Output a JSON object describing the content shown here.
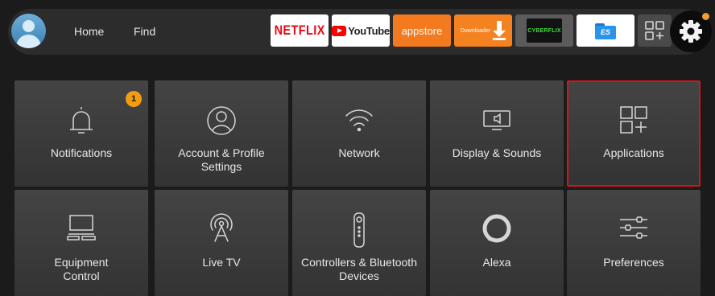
{
  "topbar": {
    "nav": {
      "home": "Home",
      "find": "Find"
    },
    "apps": {
      "netflix": "NETFLIX",
      "youtube": "YouTube",
      "appstore": "appstore",
      "downloader": "Downloader",
      "cyberflix": "CYBERFLIX"
    },
    "notification_dot_color": "#f0a030"
  },
  "settings": {
    "tiles": [
      {
        "label": "Notifications",
        "icon": "bell-icon",
        "badge": "1"
      },
      {
        "label": "Account & Profile Settings",
        "icon": "profile-icon"
      },
      {
        "label": "Network",
        "icon": "wifi-icon"
      },
      {
        "label": "Display & Sounds",
        "icon": "display-sound-icon"
      },
      {
        "label": "Applications",
        "icon": "apps-icon",
        "selected": true
      },
      {
        "label": "Equipment Control",
        "icon": "tv-equipment-icon"
      },
      {
        "label": "Live TV",
        "icon": "broadcast-antenna-icon"
      },
      {
        "label": "Controllers & Bluetooth Devices",
        "icon": "remote-icon"
      },
      {
        "label": "Alexa",
        "icon": "alexa-ring-icon"
      },
      {
        "label": "Preferences",
        "icon": "sliders-icon"
      }
    ],
    "selected_outline_color": "#e0101a",
    "badge_color": "#f39c12"
  }
}
